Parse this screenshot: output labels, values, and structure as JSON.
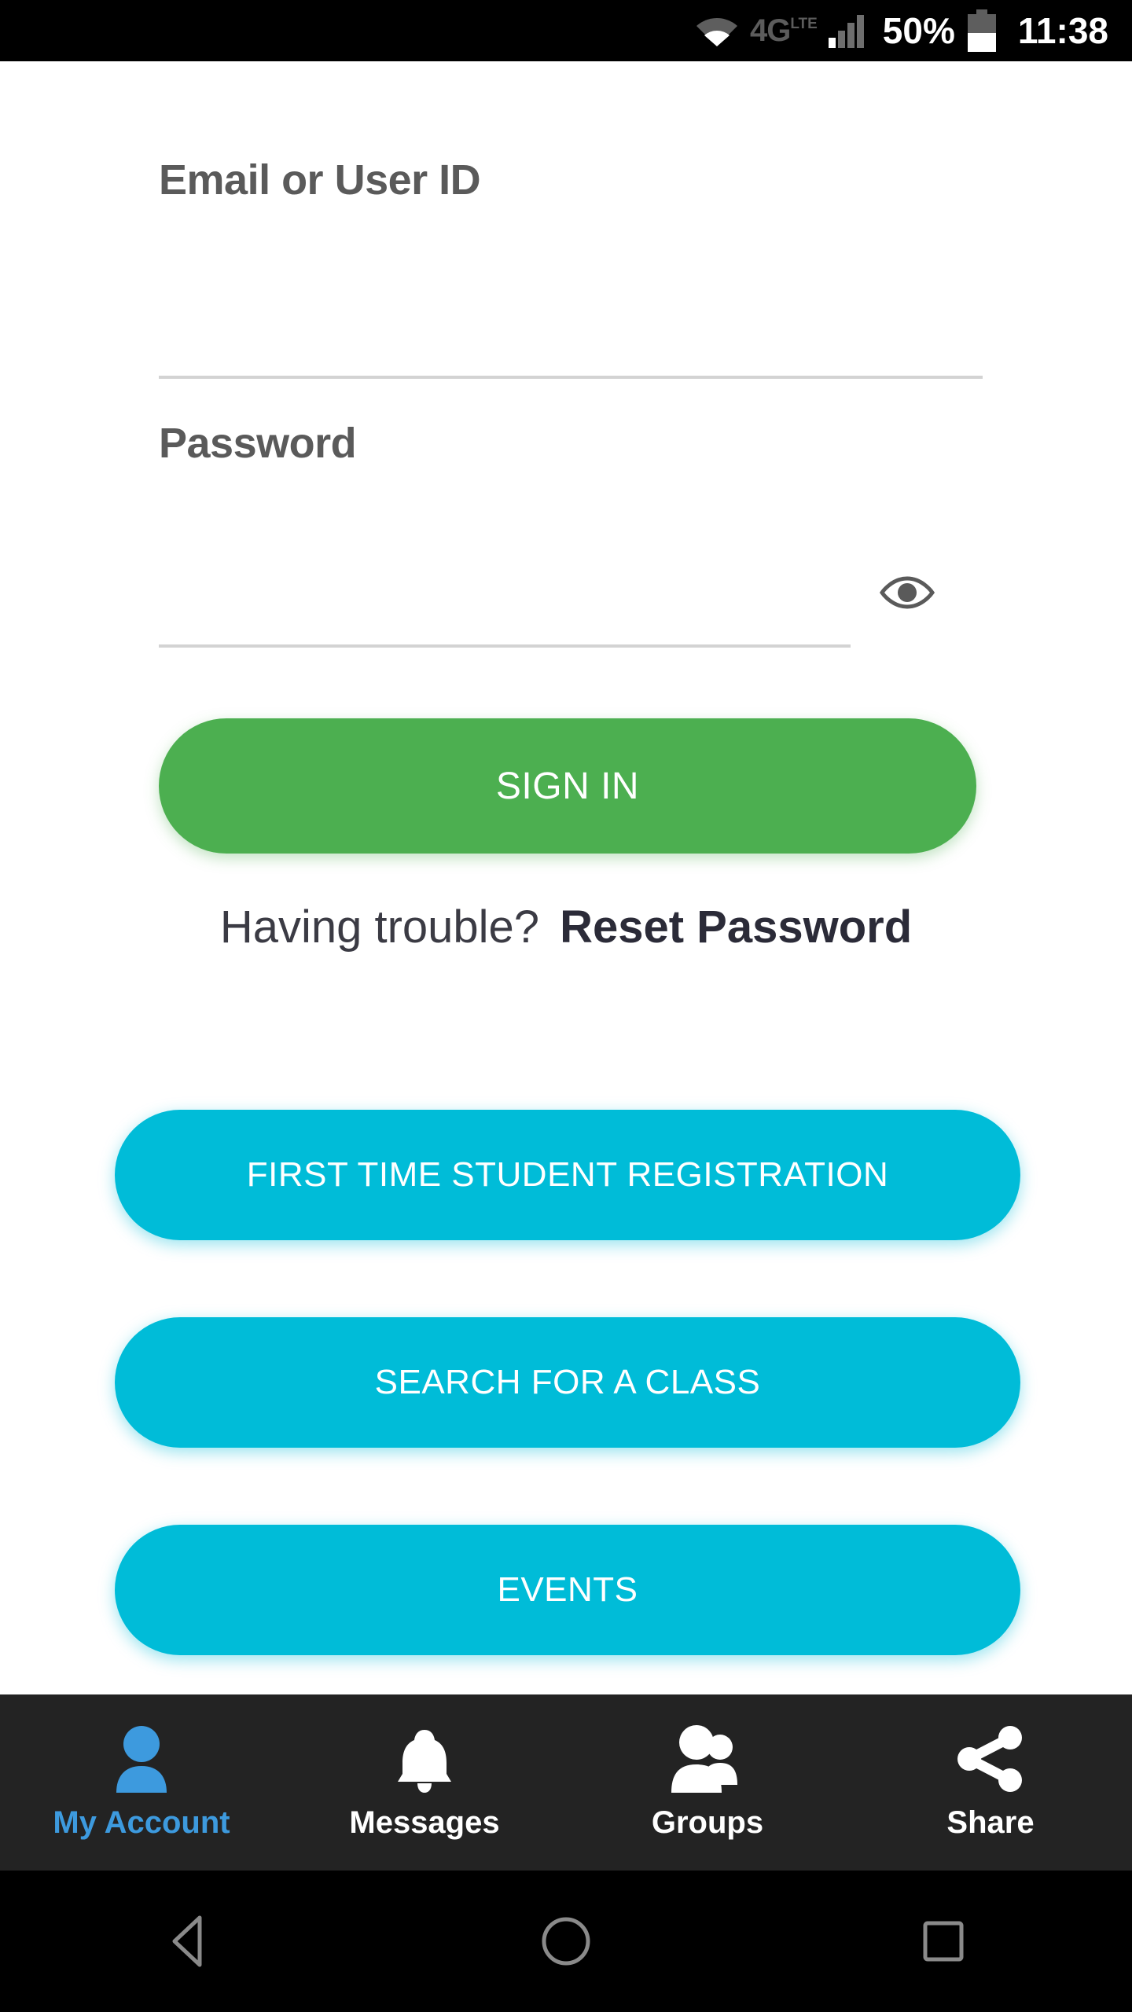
{
  "status_bar": {
    "wifi_icon": "wifi-icon",
    "network_label": "4G",
    "network_sub": "LTE",
    "signal_icon": "signal-bars-icon",
    "battery_percent": "50%",
    "battery_icon": "battery-icon",
    "time": "11:38"
  },
  "form": {
    "email": {
      "label": "Email or User ID",
      "value": "",
      "placeholder": ""
    },
    "password": {
      "label": "Password",
      "value": "",
      "placeholder": "",
      "toggle_icon": "eye-icon"
    },
    "sign_in_label": "SIGN IN"
  },
  "help": {
    "question": "Having trouble?",
    "link_label": "Reset Password"
  },
  "actions": [
    {
      "label": "FIRST TIME STUDENT REGISTRATION"
    },
    {
      "label": "SEARCH FOR A CLASS"
    },
    {
      "label": "EVENTS"
    },
    {
      "label": ""
    }
  ],
  "tabbar": [
    {
      "label": "My Account",
      "icon": "person-icon",
      "active": true
    },
    {
      "label": "Messages",
      "icon": "bell-icon",
      "active": false
    },
    {
      "label": "Groups",
      "icon": "people-icon",
      "active": false
    },
    {
      "label": "Share",
      "icon": "share-icon",
      "active": false
    }
  ],
  "android_nav": {
    "back": "back-triangle-icon",
    "home": "home-circle-icon",
    "recents": "recents-square-icon"
  },
  "colors": {
    "primary_green": "#4CAF50",
    "primary_cyan": "#00BCD8",
    "accent_blue": "#3D9ADE",
    "tabbar_bg": "#232323",
    "label_gray": "#5A5A5A",
    "underline_gray": "#D3D3D3",
    "link_navy": "#2B2B38"
  }
}
